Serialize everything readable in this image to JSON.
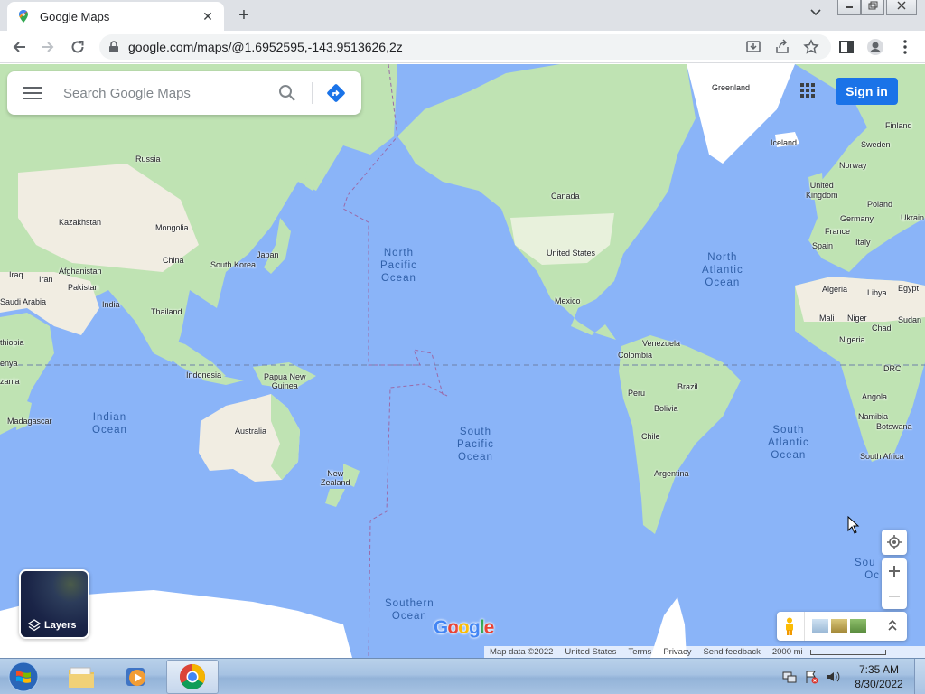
{
  "browser": {
    "tab_title": "Google Maps",
    "new_tab_symbol": "+",
    "close_symbol": "✕",
    "url": "google.com/maps/@1.6952595,-143.9513626,2z"
  },
  "maps": {
    "search_placeholder": "Search Google Maps",
    "sign_in_label": "Sign in",
    "layers_label": "Layers",
    "logo_text": "Google",
    "footer": {
      "map_data": "Map data ©2022",
      "region": "United States",
      "terms": "Terms",
      "privacy": "Privacy",
      "feedback": "Send feedback",
      "scale": "2000 mi"
    },
    "places": {
      "greenland": "Greenland",
      "iceland": "Iceland",
      "finland": "Finland",
      "sweden": "Sweden",
      "norway": "Norway",
      "united_kingdom": "United\nKingdom",
      "poland": "Poland",
      "germany": "Germany",
      "ukraine": "Ukrain",
      "france": "France",
      "italy": "Italy",
      "spain": "Spain",
      "russia": "Russia",
      "kazakhstan": "Kazakhstan",
      "mongolia": "Mongolia",
      "china": "China",
      "south_korea": "South Korea",
      "japan": "Japan",
      "iraq": "Iraq",
      "iran": "Iran",
      "afghanistan": "Afghanistan",
      "pakistan": "Pakistan",
      "saudi_arabia": "Saudi Arabia",
      "india": "India",
      "thailand": "Thailand",
      "ethiopia": "thiopia",
      "kenya": "enya",
      "tanzania": "zania",
      "madagascar": "Madagascar",
      "indonesia": "Indonesia",
      "papua": "Papua New\nGuinea",
      "australia": "Australia",
      "new_zealand": "New\nZealand",
      "canada": "Canada",
      "united_states": "United States",
      "mexico": "Mexico",
      "venezuela": "Venezuela",
      "colombia": "Colombia",
      "peru": "Peru",
      "brazil": "Brazil",
      "bolivia": "Bolivia",
      "chile": "Chile",
      "argentina": "Argentina",
      "algeria": "Algeria",
      "libya": "Libya",
      "egypt": "Egypt",
      "mali": "Mali",
      "niger": "Niger",
      "chad": "Chad",
      "sudan": "Sudan",
      "nigeria": "Nigeria",
      "drc": "DRC",
      "angola": "Angola",
      "namibia": "Namibia",
      "botswana": "Botswana",
      "south_africa": "South Africa"
    },
    "oceans": {
      "north_pacific": "North\nPacific\nOcean",
      "north_atlantic": "North\nAtlantic\nOcean",
      "indian": "Indian\nOcean",
      "south_pacific": "South\nPacific\nOcean",
      "south_atlantic": "South\nAtlantic\nOcean",
      "southern": "Southern\nOcean",
      "southern_partial": "Sou  n\nOc"
    }
  },
  "taskbar": {
    "time": "7:35 AM",
    "date": "8/30/2022"
  },
  "colors": {
    "water": "#8ab4f8",
    "land": "#bfe3b3",
    "desert": "#f1ede2",
    "ice": "#ffffff",
    "accent": "#1a73e8"
  }
}
